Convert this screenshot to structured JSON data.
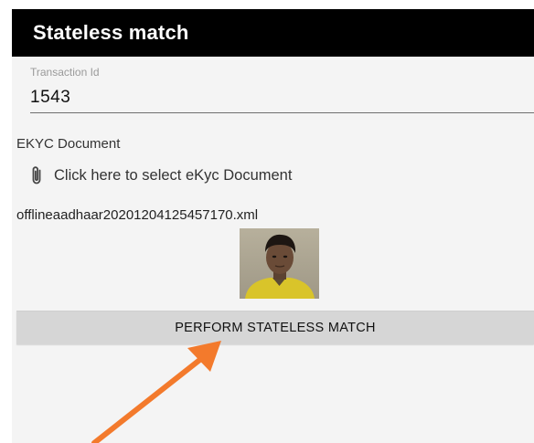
{
  "app_bar": {
    "title": "Stateless match",
    "background": "#000000"
  },
  "transaction": {
    "label": "Transaction Id",
    "value": "1543"
  },
  "ekyc": {
    "section_label": "EKYC Document",
    "select_text": "Click here to select eKyc Document",
    "select_icon": "paperclip-icon",
    "file_name": "offlineaadhaar20201204125457170.xml"
  },
  "photo": {
    "description_icon": "user-photo"
  },
  "match_button": {
    "label": "PERFORM STATELESS MATCH",
    "background": "#d6d6d6"
  },
  "annotation": {
    "arrow_color": "#f37a2c"
  }
}
